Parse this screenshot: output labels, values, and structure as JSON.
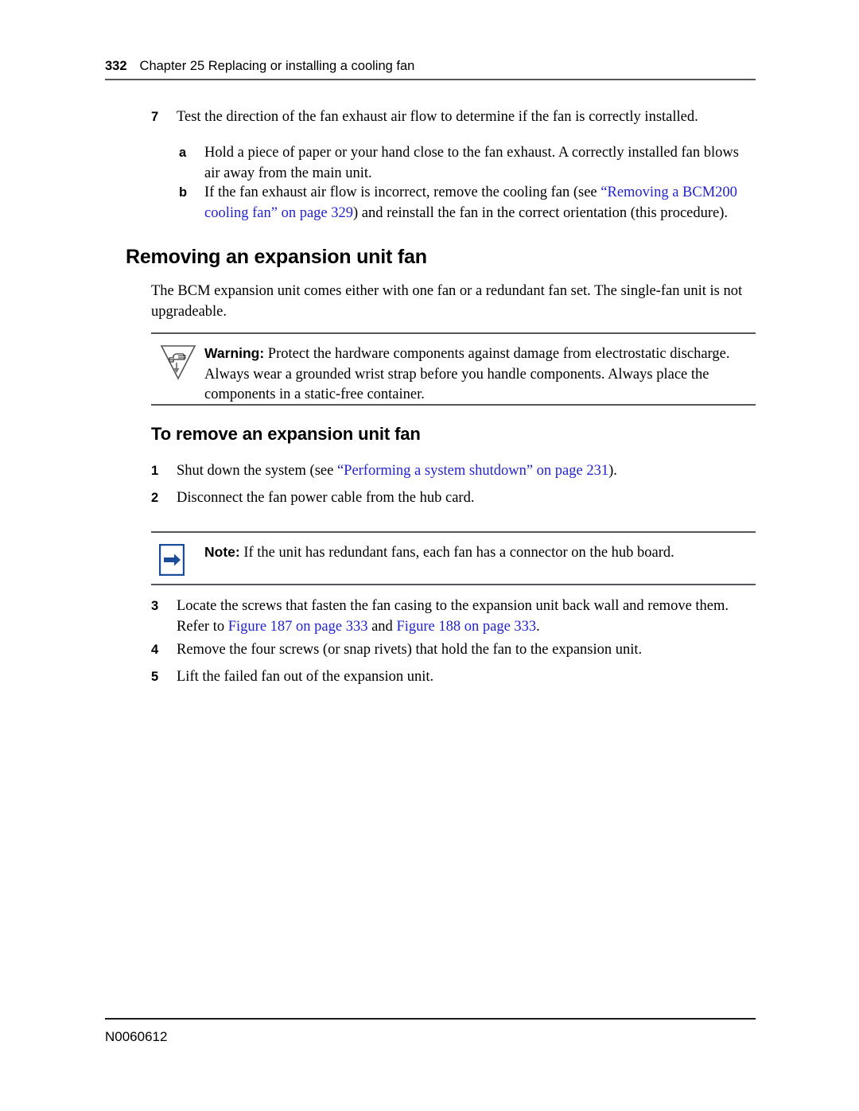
{
  "header": {
    "page_number": "332",
    "chapter_text": "Chapter 25  Replacing or installing a cooling fan"
  },
  "steps_top": [
    {
      "marker": "7",
      "text": "Test the direction of the fan exhaust air flow to determine if the fan is correctly installed."
    },
    {
      "marker": "a",
      "text": "Hold a piece of paper or your hand close to the fan exhaust. A correctly installed fan blows air away from the main unit."
    }
  ],
  "step_b": {
    "marker": "b",
    "text_before": "If the fan exhaust air flow is incorrect, remove the cooling fan (see ",
    "link": "“Removing a BCM200 cooling fan” on page 329",
    "text_after": ") and reinstall the fan in the correct orientation (this procedure)."
  },
  "heading_1": "Removing an expansion unit fan",
  "intro_paragraph": "The BCM expansion unit comes either with one fan or a redundant fan set. The single-fan unit is not upgradeable.",
  "warning": {
    "icon": "esd-warning-icon",
    "lead": "Warning:",
    "text": " Protect the hardware components against damage from electrostatic discharge. Always wear a grounded wrist strap before you handle components. Always place the components in a static-free container."
  },
  "heading_2": "To remove an expansion unit fan",
  "steps_mid": [
    {
      "marker": "1",
      "text_before": "Shut down the system (see ",
      "link": "“Performing a system shutdown” on page 231",
      "text_after": ")."
    },
    {
      "marker": "2",
      "text_before": "Disconnect the fan power cable from the hub card.",
      "link": "",
      "text_after": ""
    }
  ],
  "note": {
    "icon": "blue-arrow-note-icon",
    "lead": "Note:",
    "text": " If the unit has redundant fans, each fan has a connector on the hub board."
  },
  "step_3": {
    "marker": "3",
    "text_before": "Locate the screws that fasten the fan casing to the expansion unit back wall and remove them. Refer to ",
    "link_1": "Figure 187 on page 333",
    "text_middle": " and ",
    "link_2": "Figure 188 on page 333",
    "text_after": "."
  },
  "steps_bottom": [
    {
      "marker": "4",
      "text": "Remove the four screws (or snap rivets) that hold the fan to the expansion unit."
    },
    {
      "marker": "5",
      "text": "Lift the failed fan out of the expansion unit."
    }
  ],
  "footer": {
    "document_number": "N0060612"
  },
  "colors": {
    "link": "#2424cc",
    "rule": "#55555a",
    "note_icon": "#1a4c99"
  }
}
